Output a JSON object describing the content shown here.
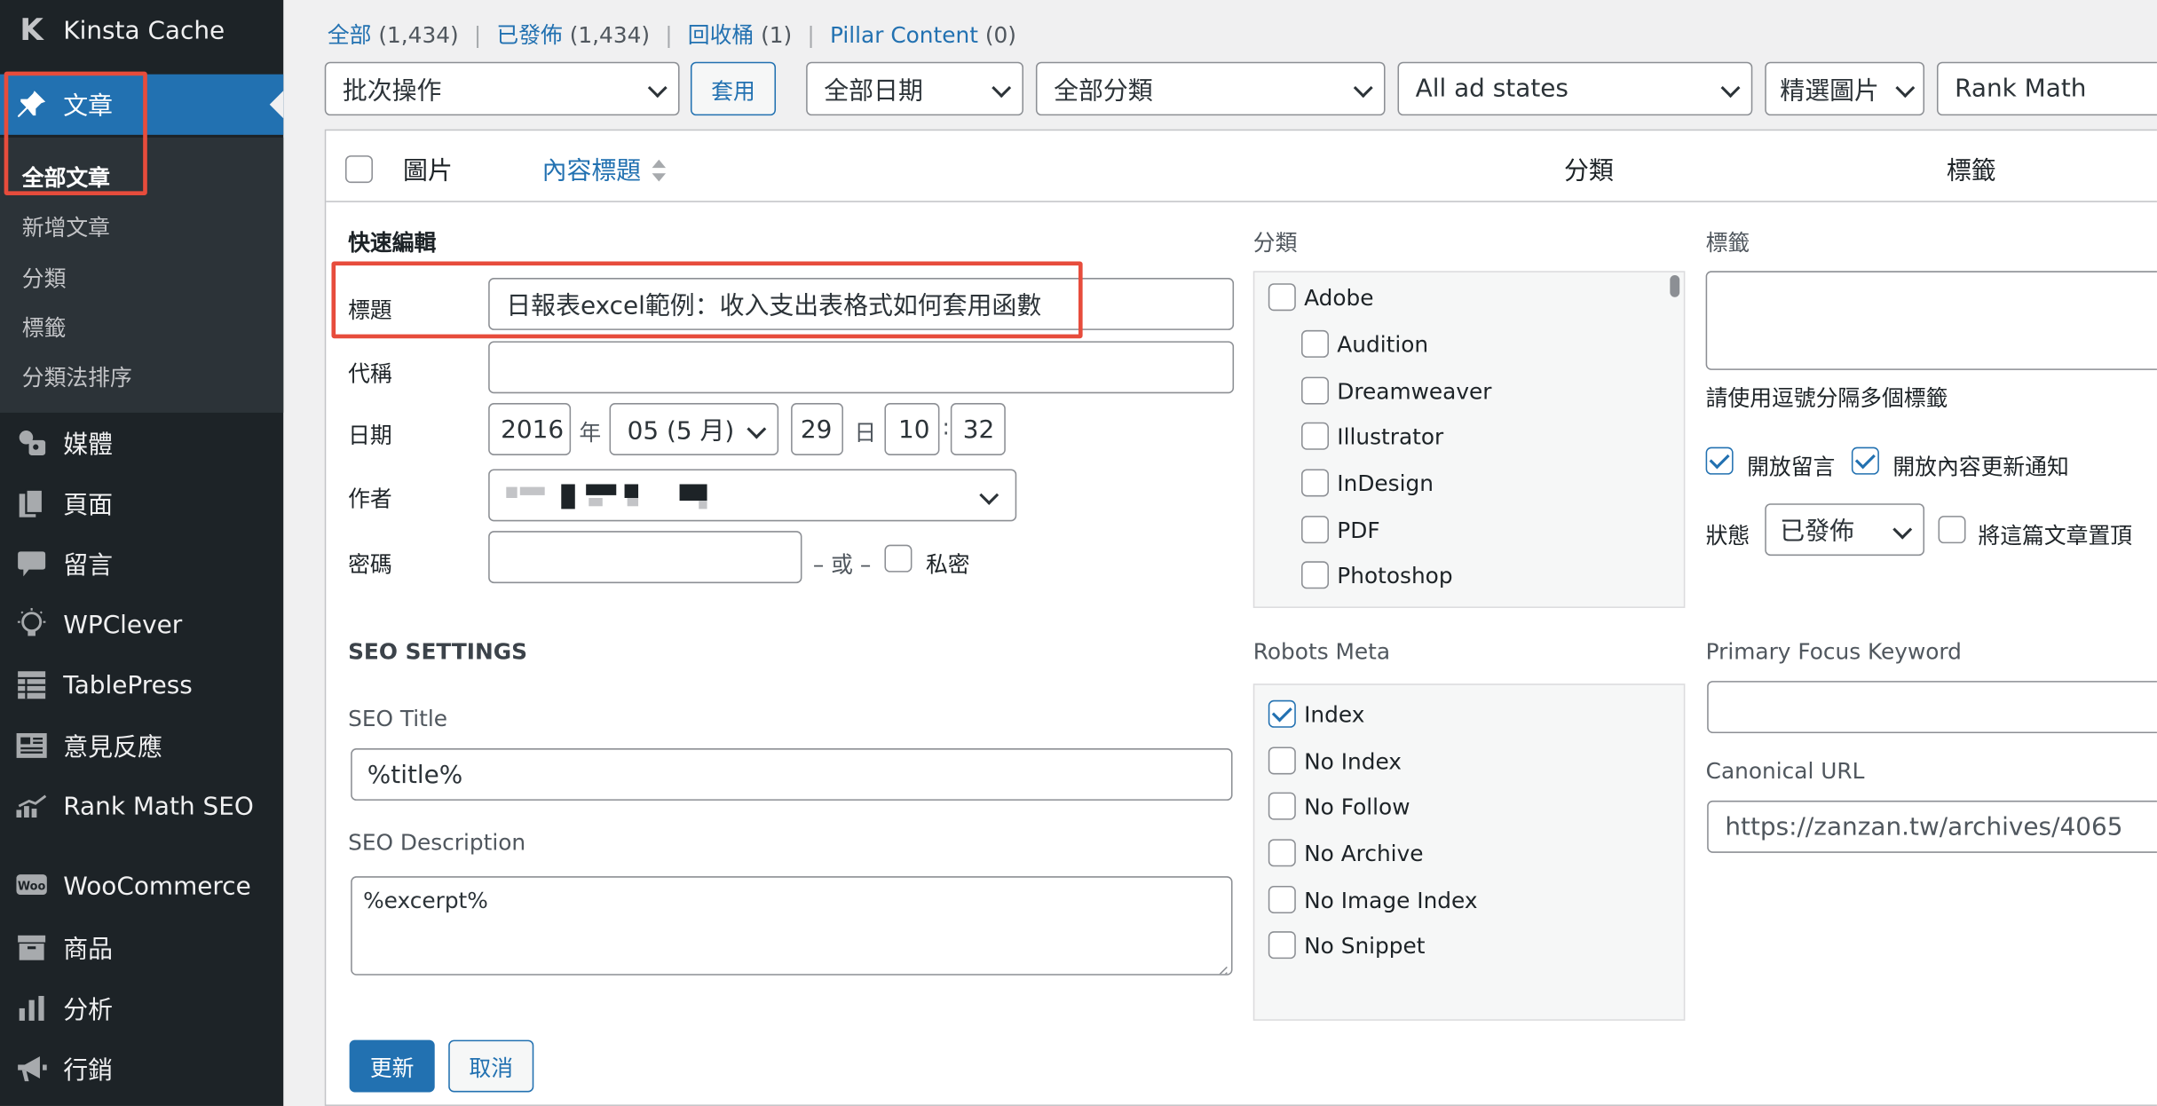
{
  "sidebar": {
    "top_item": "Kinsta Cache",
    "posts": "文章",
    "submenu": [
      "全部文章",
      "新增文章",
      "分類",
      "標籤",
      "分類法排序"
    ],
    "items": [
      "媒體",
      "頁面",
      "留言",
      "WPClever",
      "TablePress",
      "意見反應",
      "Rank Math SEO",
      "WooCommerce",
      "商品",
      "分析",
      "行銷"
    ]
  },
  "filters": {
    "all": "全部",
    "all_count": "(1,434)",
    "published": "已發佈",
    "published_count": "(1,434)",
    "trash": "回收桶",
    "trash_count": "(1)",
    "pillar": "Pillar Content",
    "pillar_count": "(0)"
  },
  "toolbar": {
    "bulk_action": "批次操作",
    "apply": "套用",
    "dates": "全部日期",
    "categories": "全部分類",
    "ad_states": "All ad states",
    "featured": "精選圖片",
    "rank_math": "Rank Math"
  },
  "table_header": {
    "image": "圖片",
    "title": "內容標題",
    "category": "分類",
    "tags": "標籤"
  },
  "quick_edit": {
    "heading": "快速編輯",
    "title_label": "標題",
    "title_value": "日報表excel範例：收入支出表格式如何套用函數",
    "slug_label": "代稱",
    "slug_value": "",
    "date_label": "日期",
    "year": "2016",
    "year_unit": "年",
    "month": "05 (5 月)",
    "day": "29",
    "day_unit": "日",
    "hour": "10",
    "time_sep": ":",
    "minute": "32",
    "author_label": "作者",
    "password_label": "密碼",
    "or_text": "– 或 –",
    "private_label": "私密"
  },
  "categories": {
    "label": "分類",
    "items": [
      "Adobe",
      "Audition",
      "Dreamweaver",
      "Illustrator",
      "InDesign",
      "PDF",
      "Photoshop"
    ]
  },
  "tags": {
    "label": "標籤",
    "hint": "請使用逗號分隔多個標籤",
    "allow_comments": "開放留言",
    "allow_pings": "開放內容更新通知",
    "status_label": "狀態",
    "status_value": "已發佈",
    "sticky": "將這篇文章置頂"
  },
  "seo": {
    "heading": "SEO SETTINGS",
    "title_label": "SEO Title",
    "title_value": "%title%",
    "desc_label": "SEO Description",
    "desc_value": "%excerpt%",
    "robots_label": "Robots Meta",
    "robots": [
      "Index",
      "No Index",
      "No Follow",
      "No Archive",
      "No Image Index",
      "No Snippet"
    ],
    "keyword_label": "Primary Focus Keyword",
    "canonical_label": "Canonical URL",
    "canonical_value": "https://zanzan.tw/archives/4065"
  },
  "actions": {
    "update": "更新",
    "cancel": "取消"
  },
  "colors": {
    "accent": "#2271b1",
    "sidebar": "#1d2327",
    "highlight": "#e74c3c"
  }
}
